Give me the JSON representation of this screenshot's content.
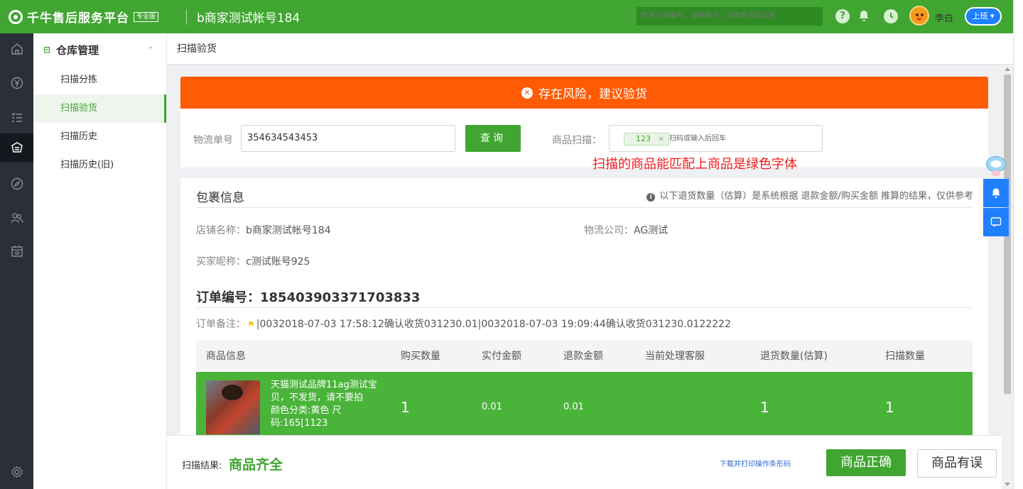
{
  "topbar": {
    "brand": "千牛售后服务平台",
    "brand_badge": "专业版",
    "shop_title": "b商家测试帐号184",
    "search_placeholder": "搜索订单编号、退款编号、退货单号或买家",
    "help_glyph": "?",
    "user_name": "李白",
    "status_label": "上班"
  },
  "rail": {
    "icons": [
      "home-icon",
      "yen-icon",
      "list-icon",
      "warehouse-icon",
      "compass-icon",
      "users-icon",
      "calendar-icon",
      "settings-icon"
    ]
  },
  "subnav": {
    "section_title": "仓库管理",
    "items": [
      {
        "label": "扫描分拣"
      },
      {
        "label": "扫描验货"
      },
      {
        "label": "扫描历史"
      },
      {
        "label": "扫描历史(旧)"
      }
    ]
  },
  "breadcrumb": "扫描验货",
  "risk_banner": "存在风险，建议验货",
  "scan_form": {
    "tracking_label": "物流单号",
    "tracking_value": "354634543453",
    "query_button": "查询",
    "scan_label": "商品扫描：",
    "scan_tag": "123",
    "scan_placeholder": "扫码或输入后回车"
  },
  "annotation": "扫描的商品能匹配上商品是绿色字体",
  "package": {
    "title": "包裹信息",
    "note": "以下退货数量（估算）是系统根据 退款金额/购买金额 推算的结果，仅供参考",
    "shop_label": "店铺名称：",
    "shop_value": "b商家测试帐号184",
    "logistics_label": "物流公司：",
    "logistics_value": "AG测试",
    "buyer_label": "买家昵称：",
    "buyer_value": "c测试账号925",
    "order_title": "订单编号：185403903371703833",
    "remark_label": "订单备注：",
    "remark_value": "|0032018-07-03 17:58:12确认收货031230.01|0032018-07-03 19:09:44确认收货031230.0122222"
  },
  "table": {
    "headers": [
      "商品信息",
      "购买数量",
      "实付金额",
      "退款金额",
      "当前处理客服",
      "退货数量(估算)",
      "扫描数量"
    ],
    "rows": [
      {
        "product_name": "天猫测试品牌11ag测试宝贝，不发货，请不要拍",
        "product_sku": "颜色分类:黄色 尺码:165[1123",
        "qty": "1",
        "paid": "0.01",
        "refund": "0.01",
        "agent": "",
        "return_qty": "1",
        "scan_qty": "1"
      }
    ]
  },
  "bottombar": {
    "result_label": "扫描结果:",
    "result_value": "商品齐全",
    "download_link": "下载并打印操作条形码",
    "ok_button": "商品正确",
    "error_button": "商品有误"
  },
  "colors": {
    "brand_green": "#40a631",
    "risk_orange": "#ff5a04",
    "row_green": "#4ab33a",
    "accent_blue": "#1e80ff",
    "annotation_red": "#f01c1c"
  }
}
